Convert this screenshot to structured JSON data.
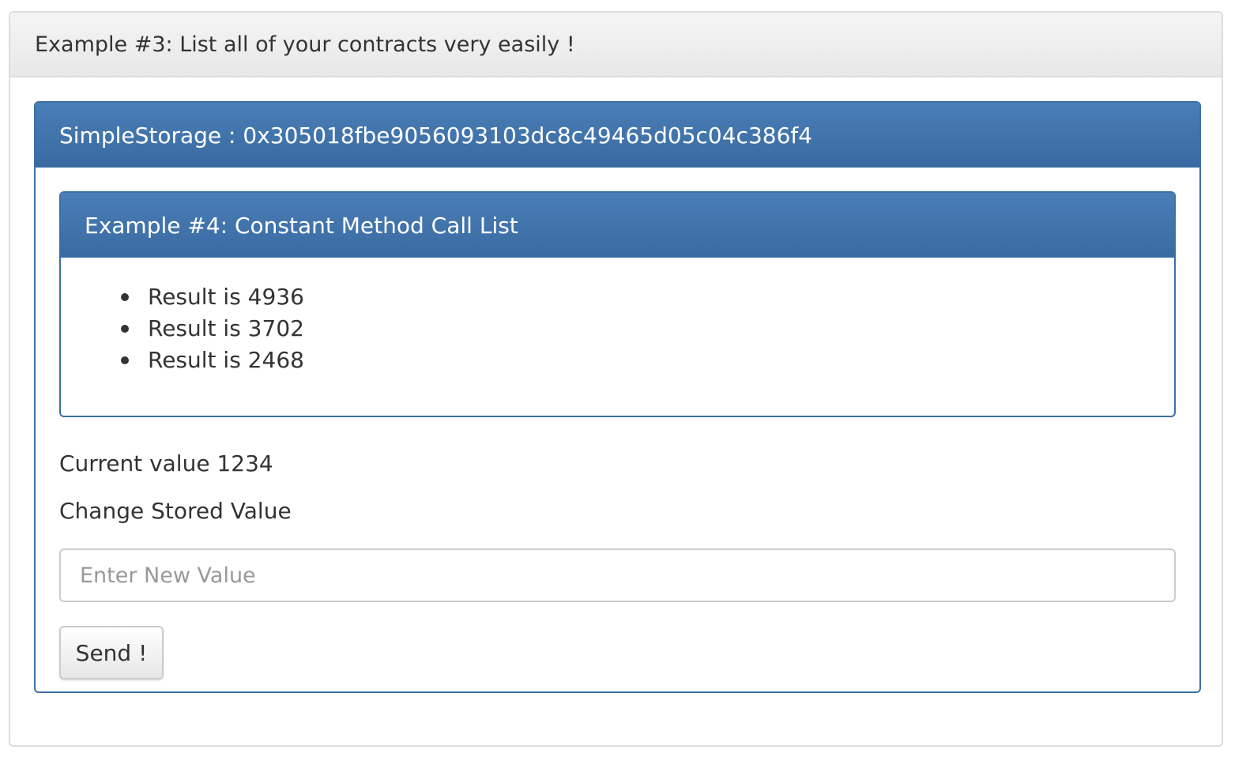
{
  "outer_panel": {
    "title": "Example #3: List all of your contracts very easily !"
  },
  "contract_panel": {
    "title": "SimpleStorage : 0x305018fbe9056093103dc8c49465d05c04c386f4"
  },
  "inner_panel": {
    "title": "Example #4: Constant Method Call List",
    "results": [
      "Result is 4936",
      "Result is 3702",
      "Result is 2468"
    ]
  },
  "current_value": "Current value 1234",
  "form": {
    "label": "Change Stored Value",
    "input_value": "",
    "input_placeholder": "Enter New Value",
    "send_label": "Send !"
  },
  "colors": {
    "primary_heading": "#3a6aa2",
    "primary_border": "#3c6fa6",
    "default_heading": "#efefef"
  }
}
